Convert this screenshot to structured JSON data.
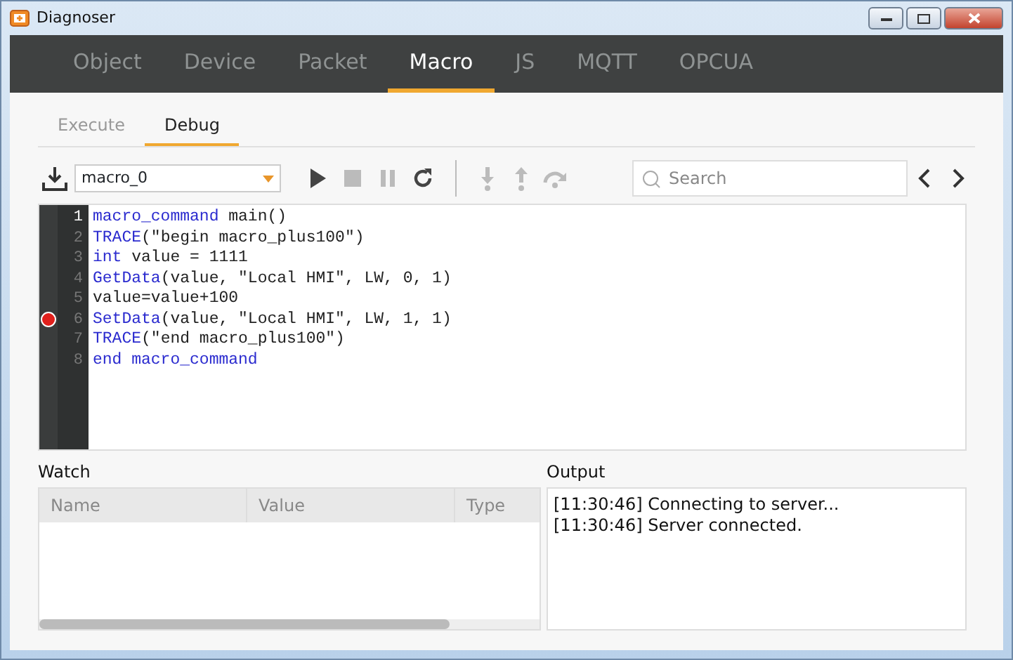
{
  "window": {
    "title": "Diagnoser"
  },
  "tabs": [
    {
      "label": "Object",
      "selected": false
    },
    {
      "label": "Device",
      "selected": false
    },
    {
      "label": "Packet",
      "selected": false
    },
    {
      "label": "Macro",
      "selected": true
    },
    {
      "label": "JS",
      "selected": false
    },
    {
      "label": "MQTT",
      "selected": false
    },
    {
      "label": "OPCUA",
      "selected": false
    }
  ],
  "subtabs": [
    {
      "label": "Execute",
      "selected": false
    },
    {
      "label": "Debug",
      "selected": true
    }
  ],
  "toolbar": {
    "macro": "macro_0",
    "search": {
      "placeholder": "Search"
    },
    "buttons": [
      {
        "kind": "play",
        "disabled": false
      },
      {
        "kind": "stop",
        "disabled": true
      },
      {
        "kind": "pause",
        "disabled": true
      },
      {
        "kind": "restart",
        "disabled": false
      },
      {
        "kind": "step-into",
        "disabled": true
      },
      {
        "kind": "step-out",
        "disabled": true
      },
      {
        "kind": "step-over",
        "disabled": true
      }
    ]
  },
  "editor": {
    "lines": [
      {
        "number": "1",
        "breakpoint": false,
        "current": true,
        "tokens": [
          {
            "text": "macro_command",
            "kind": "keyword"
          },
          {
            "text": " main()",
            "kind": "plain"
          }
        ]
      },
      {
        "number": "2",
        "breakpoint": false,
        "current": false,
        "tokens": [
          {
            "text": "TRACE",
            "kind": "keyword"
          },
          {
            "text": "(\"begin macro_plus100\")",
            "kind": "plain"
          }
        ]
      },
      {
        "number": "3",
        "breakpoint": false,
        "current": false,
        "tokens": [
          {
            "text": "int",
            "kind": "keyword"
          },
          {
            "text": " value = 1111",
            "kind": "plain"
          }
        ]
      },
      {
        "number": "4",
        "breakpoint": false,
        "current": false,
        "tokens": [
          {
            "text": "GetData",
            "kind": "keyword"
          },
          {
            "text": "(value, \"Local HMI\", LW, 0, 1)",
            "kind": "plain"
          }
        ]
      },
      {
        "number": "5",
        "breakpoint": false,
        "current": false,
        "tokens": [
          {
            "text": "value=value+100",
            "kind": "plain"
          }
        ]
      },
      {
        "number": "6",
        "breakpoint": true,
        "current": false,
        "tokens": [
          {
            "text": "SetData",
            "kind": "keyword"
          },
          {
            "text": "(value, \"Local HMI\", LW, 1, 1)",
            "kind": "plain"
          }
        ]
      },
      {
        "number": "7",
        "breakpoint": false,
        "current": false,
        "tokens": [
          {
            "text": "TRACE",
            "kind": "keyword"
          },
          {
            "text": "(\"end macro_plus100\")",
            "kind": "plain"
          }
        ]
      },
      {
        "number": "8",
        "breakpoint": false,
        "current": false,
        "tokens": [
          {
            "text": "end macro_command",
            "kind": "keyword"
          }
        ]
      }
    ]
  },
  "watch": {
    "title": "Watch",
    "columns": [
      "Name",
      "Value",
      "Type"
    ]
  },
  "output": {
    "title": "Output",
    "lines": [
      "[11:30:46] Connecting to server...",
      "[11:30:46] Server connected."
    ]
  }
}
